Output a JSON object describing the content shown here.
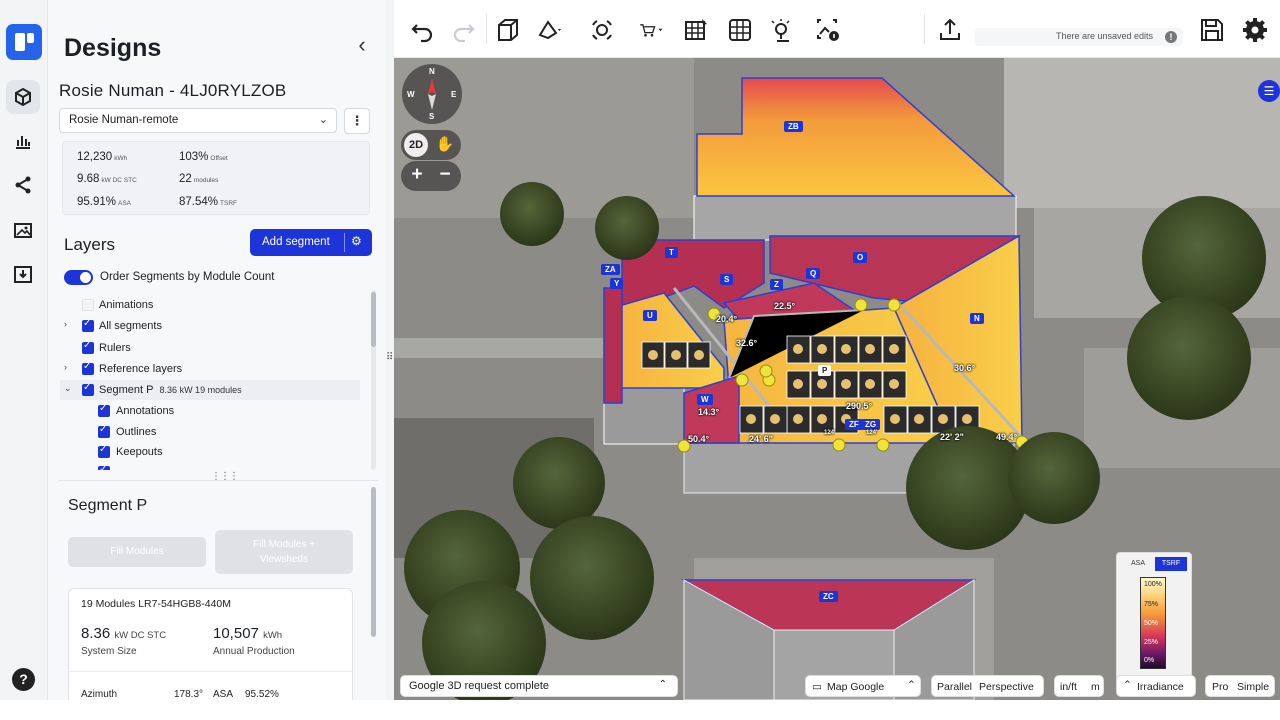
{
  "sidebar_title": "Designs",
  "project": {
    "name": "Rosie Numan - 4LJ0RYLZOB",
    "selected_design": "Rosie Numan-remote"
  },
  "stats": {
    "energy": "12,230",
    "energy_unit": "kWh",
    "offset": "103%",
    "offset_unit": "Offset",
    "size": "9.68",
    "size_unit": "kW DC STC",
    "modules": "22",
    "modules_unit": "modules",
    "asa": "95.91%",
    "asa_unit": "ASA",
    "tsrf": "87.54%",
    "tsrf_unit": "TSRF"
  },
  "layers": {
    "title": "Layers",
    "add_segment": "Add segment",
    "order_toggle": "Order Segments by Module Count",
    "items": [
      {
        "label": "Animations",
        "checked": false,
        "expand": ""
      },
      {
        "label": "All segments",
        "checked": true,
        "expand": "›"
      },
      {
        "label": "Rulers",
        "checked": true,
        "expand": ""
      },
      {
        "label": "Reference layers",
        "checked": true,
        "expand": "›"
      },
      {
        "label": "Segment P",
        "extra": "8.36 kW  19 modules",
        "checked": true,
        "expand": "⌄"
      },
      {
        "label": "Annotations",
        "checked": true
      },
      {
        "label": "Outlines",
        "checked": true
      },
      {
        "label": "Keepouts",
        "checked": true
      }
    ]
  },
  "segment": {
    "title": "Segment P",
    "fill_modules": "Fill Modules",
    "fill_viewsheds_1": "Fill Modules +",
    "fill_viewsheds_2": "Viewsheds",
    "card_head": "19 Modules  LR7-54HGB8-440M",
    "size_value": "8.36",
    "size_unit": "kW DC STC",
    "size_label": "System Size",
    "prod_value": "10,507",
    "prod_unit": "kWh",
    "prod_label": "Annual Production",
    "azimuth_label": "Azimuth",
    "azimuth_value": "178.3°",
    "asa_label": "ASA",
    "asa_value": "95.52%"
  },
  "toolbar": {
    "unsaved": "There are unsaved edits"
  },
  "map": {
    "compass": {
      "n": "N",
      "s": "S",
      "e": "E",
      "w": "W"
    },
    "view_2d": "2D",
    "zoom_in": "+",
    "zoom_out": "−",
    "status": "Google 3D request complete",
    "map_source": "Map Google",
    "projection_a": "Parallel",
    "projection_b": "Perspective",
    "units_a": "in/ft",
    "units_b": "m",
    "irradiance": "Irradiance",
    "mode_a": "Pro",
    "mode_b": "Simple",
    "legend_tab_a": "ASA",
    "legend_tab_b": "TSRF",
    "legend_ticks": [
      "100%",
      "75%",
      "50%",
      "25%",
      "0%"
    ],
    "segments": [
      "ZB",
      "T",
      "S",
      "O",
      "Q",
      "Z",
      "ZA",
      "Y",
      "U",
      "N",
      "P",
      "W",
      "ZF",
      "ZG",
      "ZC"
    ],
    "dimensions": [
      "20.4°",
      "22.5°",
      "30.6°",
      "32.6°",
      "290.5°",
      "14.3°",
      "50.4°",
      "24' 6\"",
      "22' 2\"",
      "49.4°",
      "124'",
      "124'"
    ]
  },
  "colors": {
    "accent": "#1d35d8",
    "roof_hot": "#f6a93b",
    "roof_cool": "#b8304e"
  }
}
